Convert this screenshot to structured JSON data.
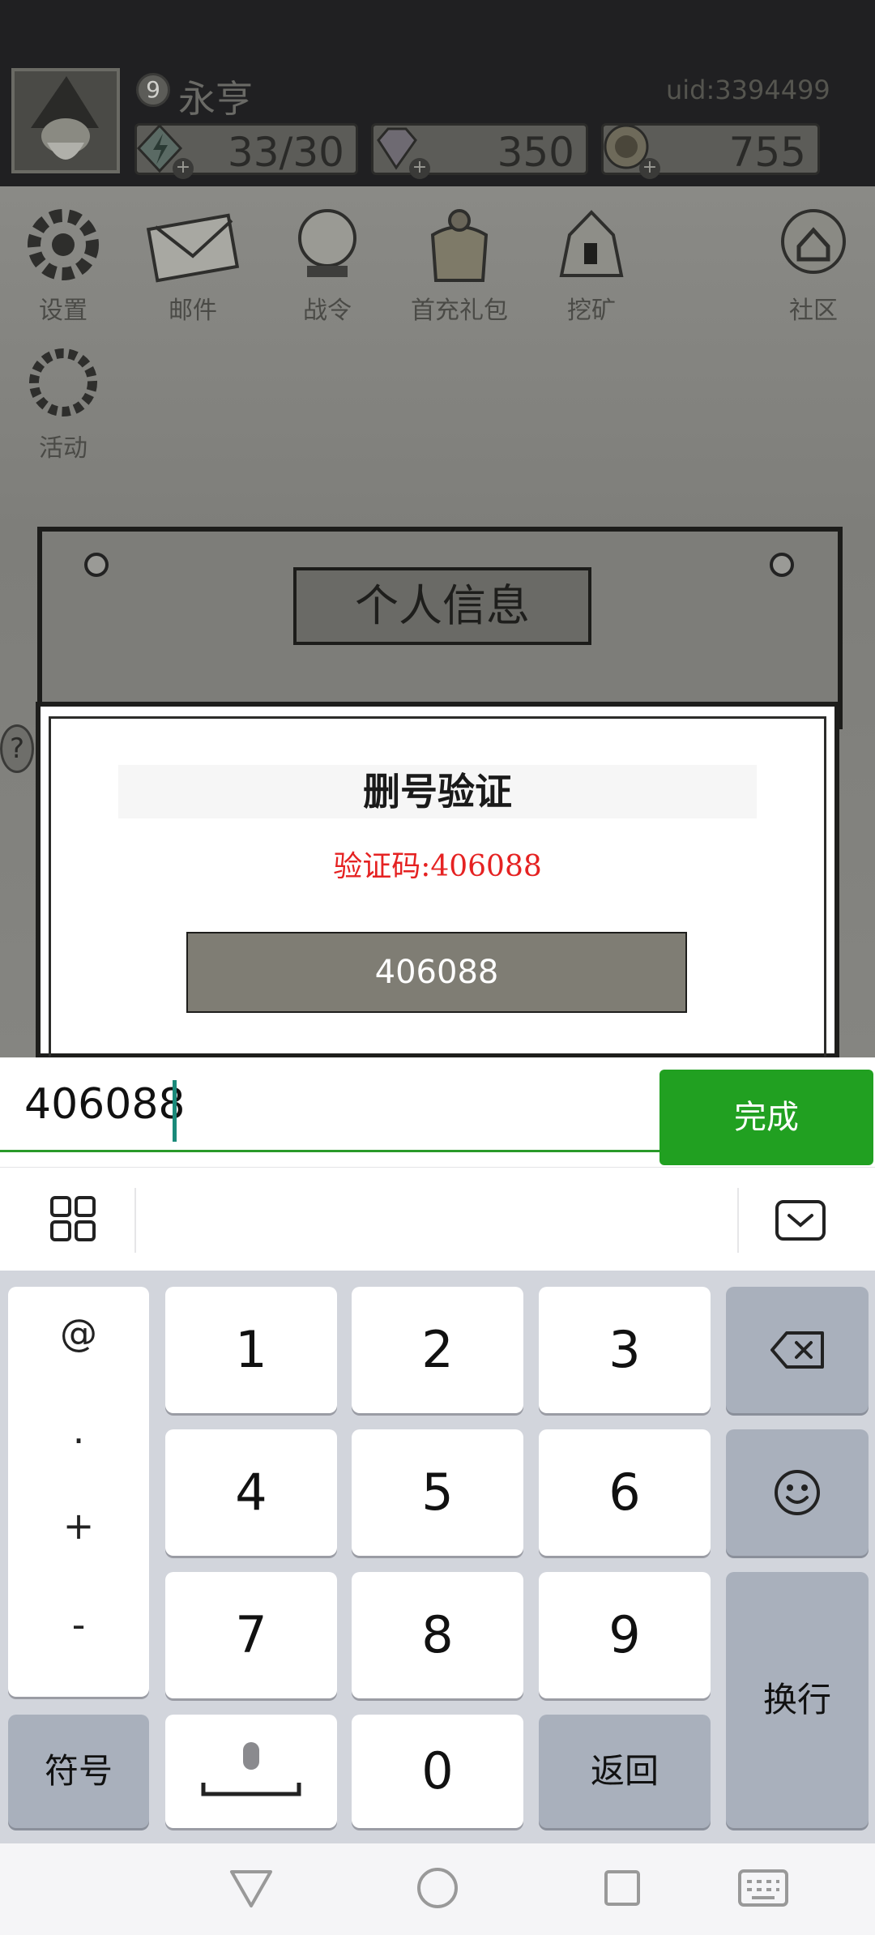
{
  "game": {
    "player_name": "永亨",
    "level": "9",
    "uid": "uid:3394499",
    "energy": "33/30",
    "gems": "350",
    "coins": "755",
    "nav": [
      "设置",
      "邮件",
      "战令",
      "首充礼包",
      "挖矿",
      "社区",
      "活动"
    ],
    "panel_title": "个人信息",
    "help_label": "?"
  },
  "dialog": {
    "title": "删号验证",
    "code_text": "验证码:406088",
    "input_value": "406088"
  },
  "input_bar": {
    "value": "406088",
    "done_label": "完成"
  },
  "keyboard": {
    "side_symbols": [
      "@",
      ".",
      "+",
      "-"
    ],
    "digits": [
      "1",
      "2",
      "3",
      "4",
      "5",
      "6",
      "7",
      "8",
      "9",
      "0"
    ],
    "symbols_label": "符号",
    "back_label": "返回",
    "enter_label": "换行"
  },
  "icons": {
    "grid": "apps-grid-icon",
    "hide": "keyboard-hide-icon",
    "backspace": "backspace-icon",
    "emoji": "emoji-icon",
    "mic": "microphone-icon"
  }
}
